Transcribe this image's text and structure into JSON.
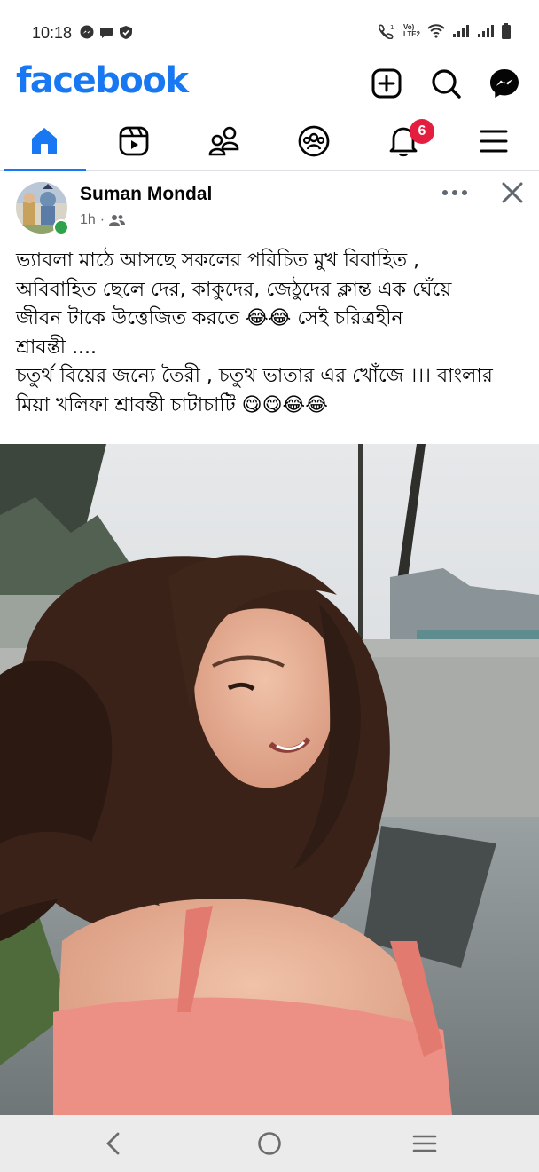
{
  "status_bar": {
    "time": "10:18",
    "left_icons": [
      "messenger-notification-icon",
      "chat-notification-icon",
      "shield-icon"
    ],
    "right_icons": [
      "volte-call-icon",
      "volte-lte2-icon",
      "wifi-icon",
      "signal-icon",
      "signal-icon",
      "battery-icon"
    ],
    "network_label_top": "Vo)",
    "network_label_bottom": "LTE2"
  },
  "header": {
    "logo": "facebook",
    "brand_color": "#1877f2",
    "actions": [
      "create-post-icon",
      "search-icon",
      "messenger-icon"
    ]
  },
  "nav": {
    "tabs": [
      "home",
      "reels",
      "friends",
      "groups",
      "notifications",
      "menu"
    ],
    "active_tab": "home",
    "notification_count": "6"
  },
  "post": {
    "author": "Suman Mondal",
    "time": "1h",
    "separator": "·",
    "audience_icon": "friends-audience-icon",
    "text_lines": [
      "ভ্যাবলা মাঠে আসছে সকলের পরিচিত মুখ বিবাহিত ,",
      "অবিবাহিত ছেলে দের,  কাকুদের, জেঠুদের ক্লান্ত এক ঘেঁয়ে",
      "জীবন টাকে  উত্তেজিত করতে 😂😂 সেই চরিত্রহীন",
      "শ্রাবন্তী ....",
      "চতুর্থ বিয়ের জন্যে তৈরী , চতুথ ভাতার এর খোঁজে ।।। বাংলার",
      "মিয়া খলিফা শ্রাবন্তী চাটাচাটি 😋😋😂😂"
    ]
  },
  "system_nav": {
    "buttons": [
      "back-icon",
      "home-circle-icon",
      "recents-icon"
    ]
  }
}
